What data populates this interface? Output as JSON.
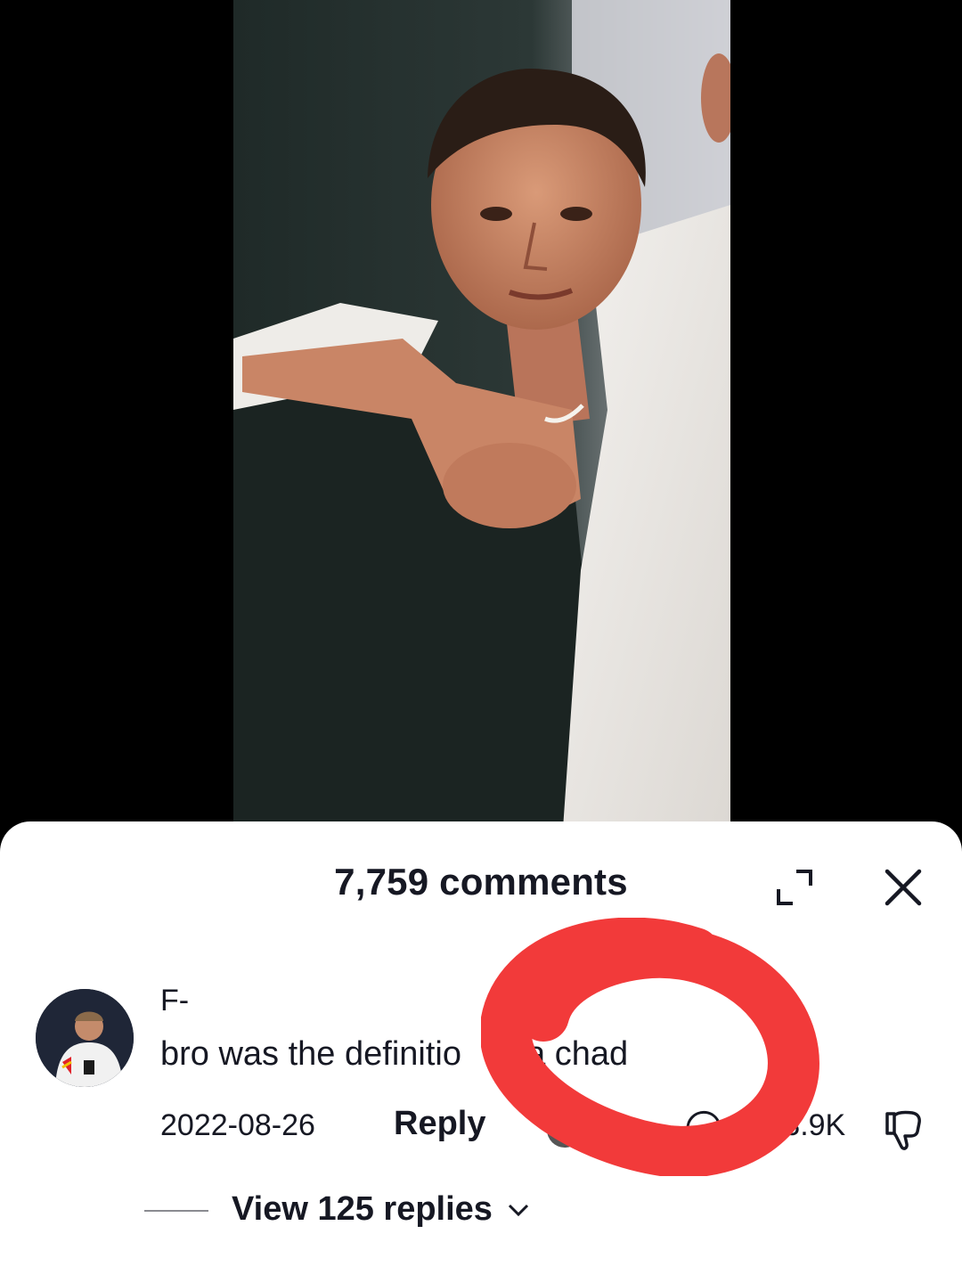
{
  "video": {
    "subject": "photo-of-young-man"
  },
  "comments_panel": {
    "title": "7,759 comments",
    "expand_icon": "expand-icon",
    "close_icon": "close-icon"
  },
  "comment": {
    "username": "F-",
    "text": "bro was the definitio",
    "text_tail": "f a chad",
    "date": "2022-08-26",
    "reply_label": "Reply",
    "like_count": "113.9K",
    "dislike_icon": "thumbs-down-icon",
    "view_replies_label": "View 125 replies",
    "chevron_icon": "chevron-down-icon"
  },
  "annotation": {
    "shape": "hand-drawn-circle",
    "color": "#f23a3a"
  },
  "colors": {
    "text_primary": "#161823",
    "sheet_background": "#ffffff",
    "backdrop": "#000000",
    "annotation_red": "#f23a3a"
  }
}
